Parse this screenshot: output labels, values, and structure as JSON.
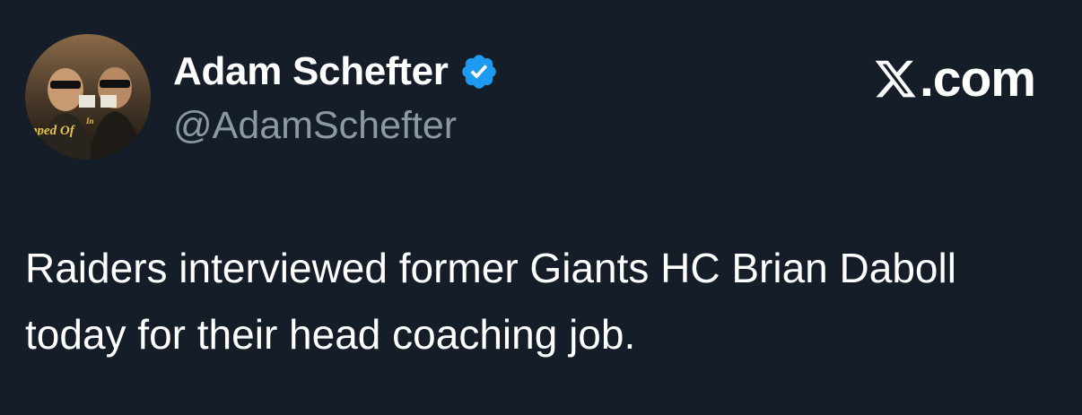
{
  "author": {
    "display_name": "Adam Schefter",
    "handle": "@AdamSchefter",
    "avatar_text": "pped Of",
    "verified": true
  },
  "brand": {
    "label": ".com",
    "icon": "x-logo-icon"
  },
  "tweet": {
    "text": "Raiders interviewed former Giants HC Brian Daboll today for their head coaching job."
  },
  "colors": {
    "background": "#151d29",
    "handle": "#8b98a5",
    "verified_badge": "#1d9bf0"
  }
}
